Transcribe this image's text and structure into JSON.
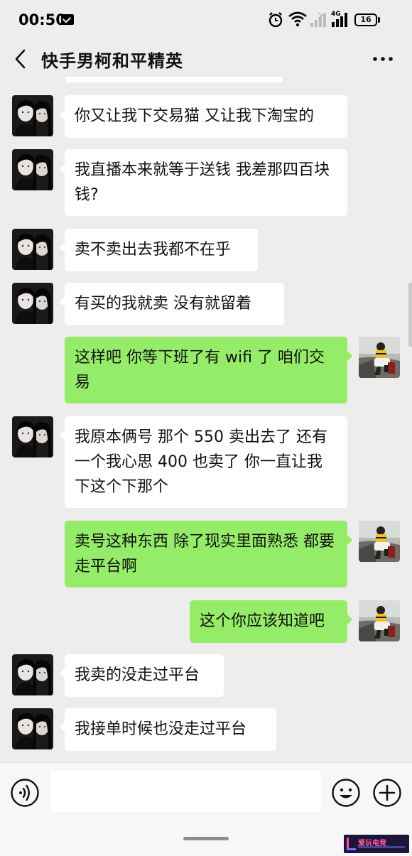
{
  "status_bar": {
    "time": "00:50",
    "network": "4G",
    "battery": "16"
  },
  "header": {
    "title": "快手男柯和平精英"
  },
  "messages": [
    {
      "side": "left",
      "text": "你又让我下交易猫 又让我下淘宝的"
    },
    {
      "side": "left",
      "text": "我直播本来就等于送钱 我差那四百块钱?"
    },
    {
      "side": "left",
      "text": "卖不卖出去我都不在乎"
    },
    {
      "side": "left",
      "text": "有买的我就卖 没有就留着"
    },
    {
      "side": "right",
      "text": "这样吧 你等下班了有 wifi 了 咱们交易"
    },
    {
      "side": "left",
      "text": "我原本俩号 那个 550 卖出去了 还有一个我心思 400 也卖了 你一直让我下这个下那个"
    },
    {
      "side": "right",
      "text": "卖号这种东西 除了现实里面熟悉 都要走平台啊"
    },
    {
      "side": "right",
      "text": "这个你应该知道吧"
    },
    {
      "side": "left",
      "text": "我卖的没走过平台"
    },
    {
      "side": "left",
      "text": "我接单时候也没走过平台"
    }
  ],
  "input_bar": {
    "placeholder": ""
  },
  "watermark": {
    "text": "爱玩电竞"
  },
  "colors": {
    "background": "#ededed",
    "incoming_bubble": "#ffffff",
    "outgoing_bubble": "#95ec69"
  }
}
